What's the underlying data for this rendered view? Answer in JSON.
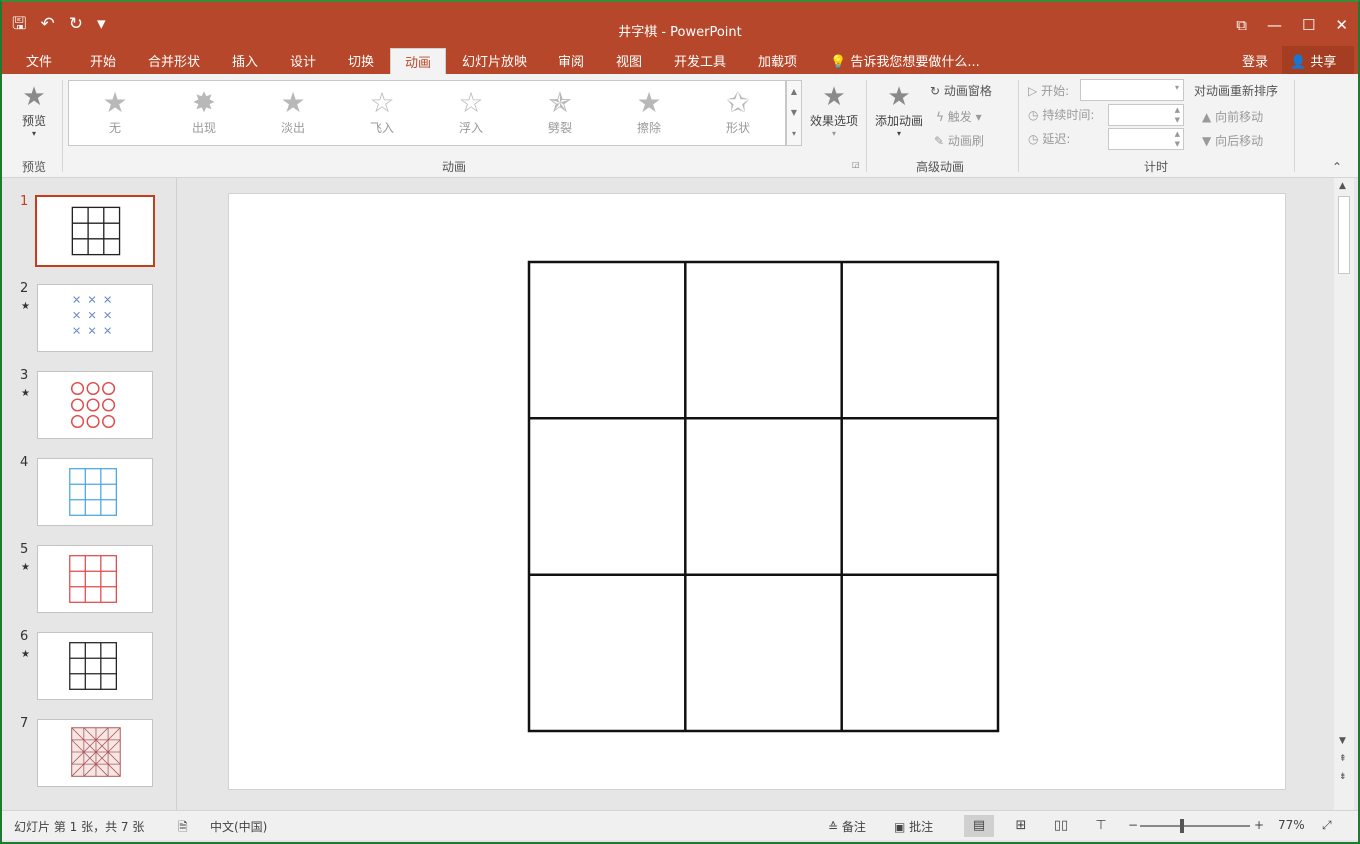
{
  "window": {
    "title": "井字棋 - PowerPoint",
    "controls": [
      "⧉",
      "—",
      "☐",
      "✕"
    ]
  },
  "qat": {
    "save_icon": "save-icon",
    "undo": "↶",
    "redo": "↻",
    "extra": "▾"
  },
  "tabs": [
    {
      "label": "文件"
    },
    {
      "label": "开始"
    },
    {
      "label": "合并形状"
    },
    {
      "label": "插入"
    },
    {
      "label": "设计"
    },
    {
      "label": "切换"
    },
    {
      "label": "动画"
    },
    {
      "label": "幻灯片放映"
    },
    {
      "label": "审阅"
    },
    {
      "label": "视图"
    },
    {
      "label": "开发工具"
    },
    {
      "label": "加载项"
    }
  ],
  "active_tab": "动画",
  "tell_me": "告诉我您想要做什么...",
  "login": "登录",
  "share": "共享",
  "ribbon": {
    "preview": {
      "label": "预览",
      "group": "预览"
    },
    "gallery": {
      "items": [
        "无",
        "出现",
        "淡出",
        "飞入",
        "浮入",
        "劈裂",
        "擦除",
        "形状"
      ],
      "group": "动画"
    },
    "effect_options": "效果选项",
    "advanced": {
      "add_animation": "添加动画",
      "animation_pane": "动画窗格",
      "trigger": "触发",
      "painter": "动画刷",
      "group": "高级动画"
    },
    "timing": {
      "start": "开始:",
      "duration": "持续时间:",
      "delay": "延迟:",
      "reorder": "对动画重新排序",
      "move_earlier": "向前移动",
      "move_later": "向后移动",
      "group": "计时"
    }
  },
  "slides": [
    {
      "num": "1",
      "star": ""
    },
    {
      "num": "2",
      "star": "★"
    },
    {
      "num": "3",
      "star": "★"
    },
    {
      "num": "4",
      "star": ""
    },
    {
      "num": "5",
      "star": "★"
    },
    {
      "num": "6",
      "star": "★"
    },
    {
      "num": "7",
      "star": ""
    }
  ],
  "status": {
    "slide_info": "幻灯片 第 1 张，共 7 张",
    "language": "中文(中国)",
    "notes": "备注",
    "comments": "批注",
    "zoom": "77%"
  },
  "colors": {
    "accent": "#b7472a",
    "thumb_x": "#5b7fc0",
    "thumb_circle": "#e04a4a",
    "thumb_blue_grid": "#4aa8e0",
    "thumb_red_grid": "#e04a4a"
  }
}
